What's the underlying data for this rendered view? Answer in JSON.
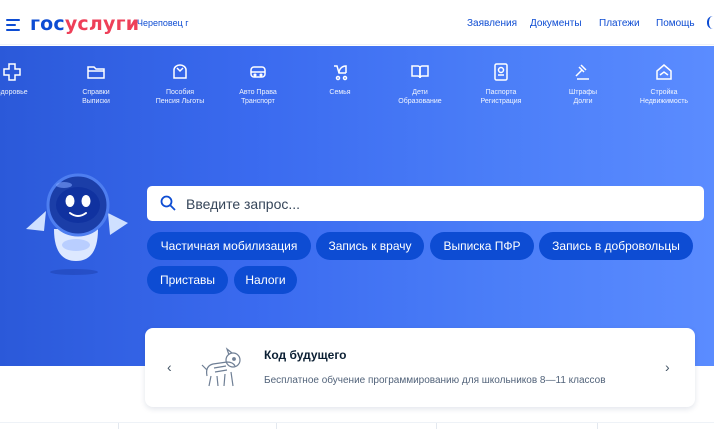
{
  "header": {
    "logo_part1": "гос",
    "logo_part2": "услуги",
    "city": "Череповец г",
    "nav": [
      "Заявления",
      "Документы",
      "Платежи",
      "Помощь"
    ]
  },
  "categories": [
    {
      "label": "Здоровье",
      "icon": "health-icon"
    },
    {
      "label": "Справки\nВыписки",
      "icon": "folder-icon"
    },
    {
      "label": "Пособия\nПенсия Льготы",
      "icon": "wallet-icon"
    },
    {
      "label": "Авто Права\nТранспорт",
      "icon": "car-icon"
    },
    {
      "label": "Семья",
      "icon": "stroller-icon"
    },
    {
      "label": "Дети\nОбразование",
      "icon": "book-icon"
    },
    {
      "label": "Паспорта\nРегистрация",
      "icon": "passport-icon"
    },
    {
      "label": "Штрафы\nДолги",
      "icon": "gavel-icon"
    },
    {
      "label": "Стройка\nНедвижимость",
      "icon": "house-icon"
    }
  ],
  "search": {
    "placeholder": "Введите запрос..."
  },
  "quick_links": [
    "Частичная мобилизация",
    "Запись к врачу",
    "Выписка ПФР",
    "Запись в добровольцы",
    "Приставы",
    "Налоги"
  ],
  "promo": {
    "title": "Код будущего",
    "text": "Бесплатное обучение программированию для школьников 8—11 классов",
    "prev": "‹",
    "next": "›"
  },
  "colors": {
    "brand_blue": "#0d4cd3",
    "brand_red": "#ee3f58",
    "hero_start": "#2b59d9",
    "hero_end": "#5b8cff"
  }
}
